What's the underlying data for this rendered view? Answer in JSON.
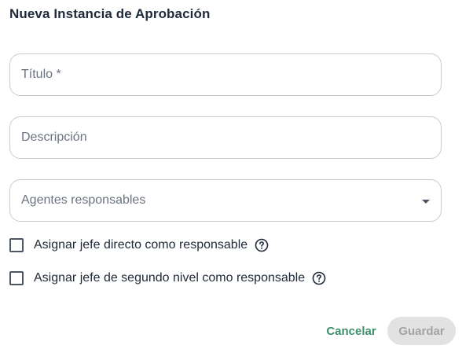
{
  "dialog": {
    "title": "Nueva Instancia de Aprobación"
  },
  "form": {
    "title_field": {
      "placeholder": "Título *"
    },
    "description_field": {
      "placeholder": "Descripción"
    },
    "agents_select": {
      "placeholder": "Agentes responsables"
    },
    "checkboxes": [
      {
        "label": "Asignar jefe directo como responsable",
        "checked": false
      },
      {
        "label": "Asignar jefe de segundo nivel como responsable",
        "checked": false
      }
    ]
  },
  "actions": {
    "cancel_label": "Cancelar",
    "save_label": "Guardar"
  },
  "colors": {
    "accent": "#3f8f6e",
    "disabled_bg": "#e2e2e2",
    "disabled_text": "#a3a3a3",
    "border": "#c9ccd1"
  },
  "icons": {
    "help": "help-circle-icon",
    "dropdown": "caret-down-icon"
  }
}
